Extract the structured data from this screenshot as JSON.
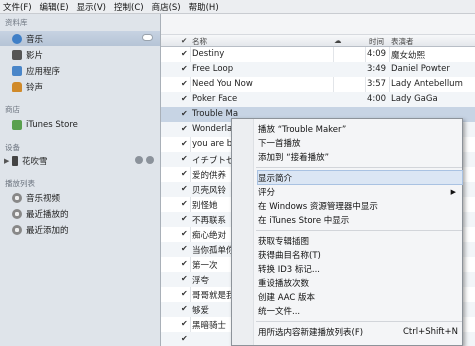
{
  "menubar": [
    "文件(F)",
    "编辑(E)",
    "显示(V)",
    "控制(C)",
    "商店(S)",
    "帮助(H)"
  ],
  "sidebar": {
    "library_header": "资料库",
    "library": [
      {
        "label": "音乐",
        "icon": "music-note-icon"
      },
      {
        "label": "影片",
        "icon": "film-icon"
      },
      {
        "label": "应用程序",
        "icon": "app-icon"
      },
      {
        "label": "铃声",
        "icon": "bell-icon"
      }
    ],
    "store_header": "商店",
    "store": [
      {
        "label": "iTunes Store",
        "icon": "store-icon"
      }
    ],
    "devices_header": "设备",
    "devices": [
      {
        "label": "花吹雪",
        "icon": "phone-icon"
      }
    ],
    "playlists_header": "播放列表",
    "playlists": [
      {
        "label": "音乐视频",
        "icon": "gear-icon"
      },
      {
        "label": "最近播放的",
        "icon": "gear-icon"
      },
      {
        "label": "最近添加的",
        "icon": "gear-icon"
      }
    ]
  },
  "list": {
    "header": {
      "name": "名称",
      "time": "时间",
      "artist": "表演者"
    },
    "rows": [
      {
        "name": "Destiny",
        "time": "4:09",
        "artist": "魔女幼熙"
      },
      {
        "name": "Free Loop",
        "time": "3:49",
        "artist": "Daniel Powter"
      },
      {
        "name": "Need You Now",
        "time": "3:57",
        "artist": "Lady Antebellum"
      },
      {
        "name": "Poker Face",
        "time": "4:00",
        "artist": "Lady GaGa"
      },
      {
        "name": "Trouble Ma",
        "time": "",
        "artist": ""
      },
      {
        "name": "Wonderlan",
        "time": "",
        "artist": ""
      },
      {
        "name": "you are bea",
        "time": "",
        "artist": ""
      },
      {
        "name": "イチブトゼ",
        "time": "",
        "artist": ""
      },
      {
        "name": "爱的供养",
        "time": "",
        "artist": ""
      },
      {
        "name": "贝壳风铃",
        "time": "",
        "artist": ""
      },
      {
        "name": "别怪她",
        "time": "",
        "artist": ""
      },
      {
        "name": "不再联系",
        "time": "",
        "artist": ""
      },
      {
        "name": "痴心绝对",
        "time": "",
        "artist": ""
      },
      {
        "name": "当你孤单你",
        "time": "",
        "artist": ""
      },
      {
        "name": "第一次",
        "time": "",
        "artist": ""
      },
      {
        "name": "浮夸",
        "time": "",
        "artist": ""
      },
      {
        "name": "哥哥就是我",
        "time": "",
        "artist": ""
      },
      {
        "name": "够爱",
        "time": "",
        "artist": ""
      },
      {
        "name": "黑暗骑士",
        "time": "",
        "artist": ""
      },
      {
        "name": "",
        "time": "",
        "artist": ""
      }
    ]
  },
  "context_menu": {
    "items": [
      {
        "label": "播放 “Trouble Maker”"
      },
      {
        "label": "下一首播放"
      },
      {
        "label": "添加到 “接着播放”"
      },
      {
        "sep": true
      },
      {
        "label": "显示简介",
        "highlight": true
      },
      {
        "label": "评分",
        "submenu": true
      },
      {
        "label": "在 Windows 资源管理器中显示"
      },
      {
        "label": "在 iTunes Store 中显示"
      },
      {
        "sep": true
      },
      {
        "label": "获取专辑插图"
      },
      {
        "label": "获得曲目名称(T)"
      },
      {
        "label": "转换 ID3 标记..."
      },
      {
        "label": "重设播放次数"
      },
      {
        "label": "创建 AAC 版本"
      },
      {
        "label": "统一文件..."
      },
      {
        "sep": true
      },
      {
        "label": "用所选内容新建播放列表(F)",
        "shortcut": "Ctrl+Shift+N"
      }
    ]
  },
  "colors": {
    "selection": "#c7d4e4",
    "sidebar_bg": "#dfe4ea",
    "menu_highlight": "#dbe6f4"
  }
}
